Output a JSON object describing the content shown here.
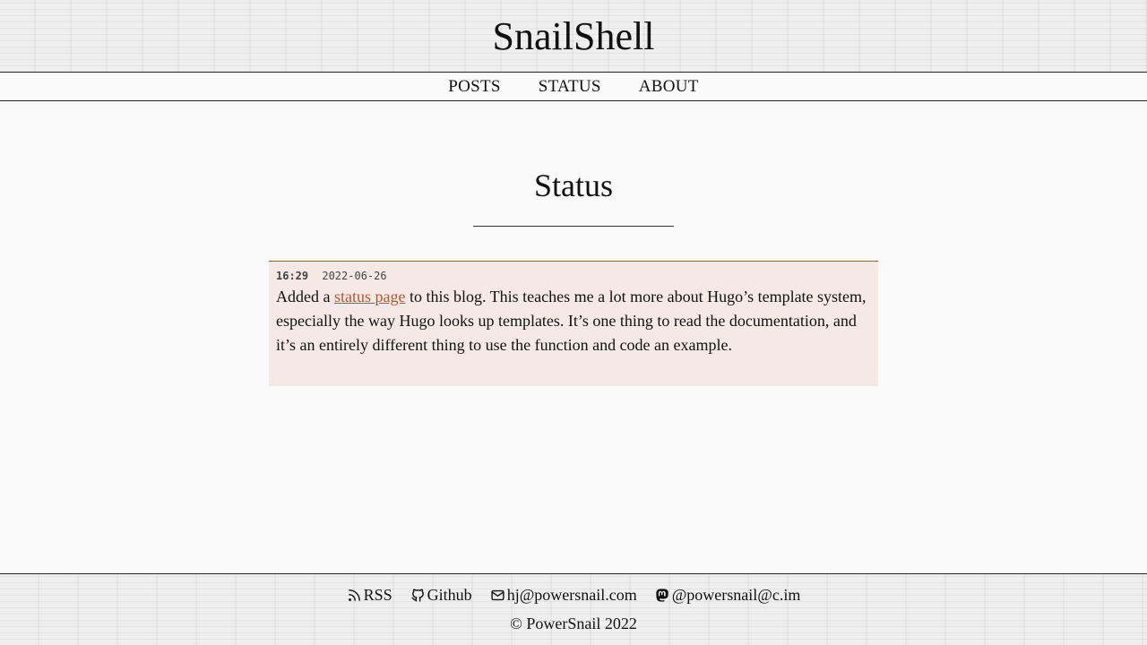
{
  "site": {
    "title": "SnailShell"
  },
  "nav": {
    "items": [
      {
        "label": "POSTS"
      },
      {
        "label": "STATUS"
      },
      {
        "label": "ABOUT"
      }
    ]
  },
  "main": {
    "heading": "Status",
    "statuses": [
      {
        "time": "16:29",
        "date": "2022-06-26",
        "text_before": "Added a ",
        "link_text": "status page",
        "text_after": " to this blog. This teaches me a lot more about Hugo’s template system, especially the way Hugo looks up templates. It’s one thing to read the documentation, and it’s an entirely different thing to use the function and code an example."
      }
    ]
  },
  "footer": {
    "links": [
      {
        "icon": "rss-icon",
        "label": "RSS"
      },
      {
        "icon": "github-icon",
        "label": "Github"
      },
      {
        "icon": "mail-icon",
        "label": "hj@powersnail.com"
      },
      {
        "icon": "mastodon-icon",
        "label": "@powersnail@c.im"
      }
    ],
    "copyright": "© PowerSnail 2022"
  },
  "colors": {
    "accent": "#b3562e",
    "card_background": "#f5e9e6",
    "page_background": "#fafafa"
  }
}
